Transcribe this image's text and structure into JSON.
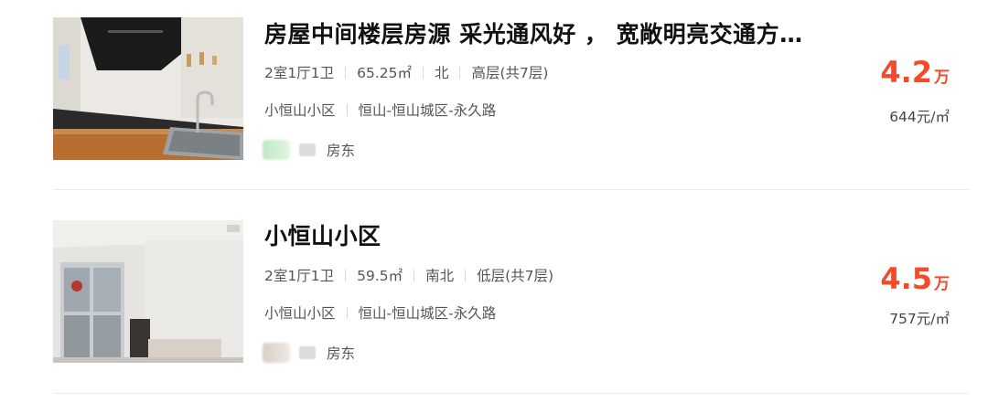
{
  "listings": [
    {
      "title": "房屋中间楼层房源 采光通风好 ， 宽敞明亮交通方…",
      "layout": "2室1厅1卫",
      "area": "65.25㎡",
      "orientation": "北",
      "floor": "高层(共7层)",
      "community": "小恒山小区",
      "district": "恒山-恒山城区-永久路",
      "owner_label": "房东",
      "price": "4.2",
      "price_unit": "万",
      "unit_price": "644元/㎡",
      "photo": "kitchen-photo"
    },
    {
      "title": "小恒山小区",
      "layout": "2室1厅1卫",
      "area": "59.5㎡",
      "orientation": "南北",
      "floor": "低层(共7层)",
      "community": "小恒山小区",
      "district": "恒山-恒山城区-永久路",
      "owner_label": "房东",
      "price": "4.5",
      "price_unit": "万",
      "unit_price": "757元/㎡",
      "photo": "room-photo"
    }
  ],
  "colors": {
    "price": "#f24a2a",
    "text_secondary": "#555555",
    "title": "#111111",
    "divider": "#ececec"
  }
}
